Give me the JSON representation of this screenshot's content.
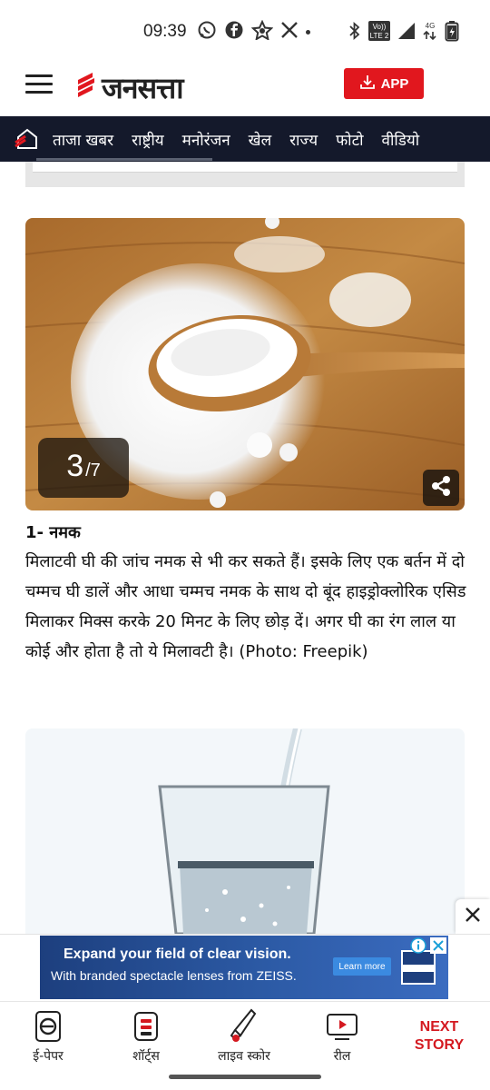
{
  "status_bar": {
    "time": "09:39",
    "network": "4G",
    "volte_label_1": "Vo))",
    "volte_label_2": "LTE 2"
  },
  "header": {
    "logo_text": "जनसत्ता",
    "app_button_label": "APP"
  },
  "nav": {
    "items": [
      "ताजा खबर",
      "राष्ट्रीय",
      "मनोरंजन",
      "खेल",
      "राज्य",
      "फोटो",
      "वीडियो"
    ]
  },
  "slide": {
    "counter_current": "3",
    "counter_total": "/7",
    "caption_title": "1- नमक",
    "caption_body": "मिलाटवी घी की जांच नमक से भी कर सकते हैं। इसके लिए एक बर्तन में दो चम्मच घी डालें और आधा चम्मच नमक के साथ दो बूंद हाइड्रोक्लोरिक एसिड मिलाकर मिक्स करके 20 मिनट के लिए छोड़ दें। अगर घी का रंग लाल या कोई और होता है तो ये मिलावटी है। (Photo: Freepik)"
  },
  "ad": {
    "headline": "Expand your field of clear vision.",
    "subline": "With branded  spectacle lenses from ZEISS.",
    "cta": "Learn more"
  },
  "bottom_bar": {
    "epaper": "ई-पेपर",
    "shorts": "शॉर्ट्स",
    "live_score": "लाइव स्कोर",
    "reel": "रील",
    "next_story": "NEXT STORY"
  },
  "colors": {
    "brand_red": "#e1171e",
    "nav_bg": "#14192b",
    "next_story_red": "#d41920"
  }
}
